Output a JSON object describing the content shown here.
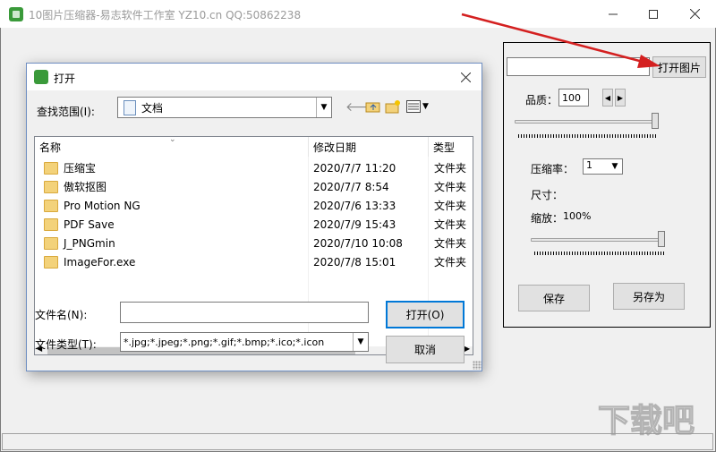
{
  "window": {
    "title": "10图片压缩器-易志软件工作室 YZ10.cn   QQ:50862238"
  },
  "panel": {
    "path_value": "",
    "open_image_label": "打开图片",
    "quality_label": "品质：",
    "quality_value": "100",
    "compression_label": "压缩率：",
    "compression_value": "1",
    "size_label": "尺寸：",
    "zoom_label": "缩放：",
    "zoom_value": "100%",
    "save_label": "保存",
    "save_as_label": "另存为"
  },
  "dialog": {
    "title": "打开",
    "look_in_label": "查找范围(I):",
    "look_in_value": "文档",
    "columns": {
      "name": "名称",
      "date": "修改日期",
      "type": "类型"
    },
    "files": [
      {
        "name": "压缩宝",
        "date": "2020/7/7 11:20",
        "type": "文件夹"
      },
      {
        "name": "傲软抠图",
        "date": "2020/7/7 8:54",
        "type": "文件夹"
      },
      {
        "name": "Pro Motion NG",
        "date": "2020/7/6 13:33",
        "type": "文件夹"
      },
      {
        "name": "PDF Save",
        "date": "2020/7/9 15:43",
        "type": "文件夹"
      },
      {
        "name": "J_PNGmin",
        "date": "2020/7/10 10:08",
        "type": "文件夹"
      },
      {
        "name": "ImageFor.exe",
        "date": "2020/7/8 15:01",
        "type": "文件夹"
      }
    ],
    "filename_label": "文件名(N):",
    "filename_value": "",
    "filetype_label": "文件类型(T):",
    "filetype_value": "*.jpg;*.jpeg;*.png;*.gif;*.bmp;*.ico;*.icon",
    "open_label": "打开(O)",
    "cancel_label": "取消"
  },
  "colors": {
    "arrow": "#d42020",
    "dialog_border": "#6e8ec2",
    "folder": "#f3d27a"
  }
}
